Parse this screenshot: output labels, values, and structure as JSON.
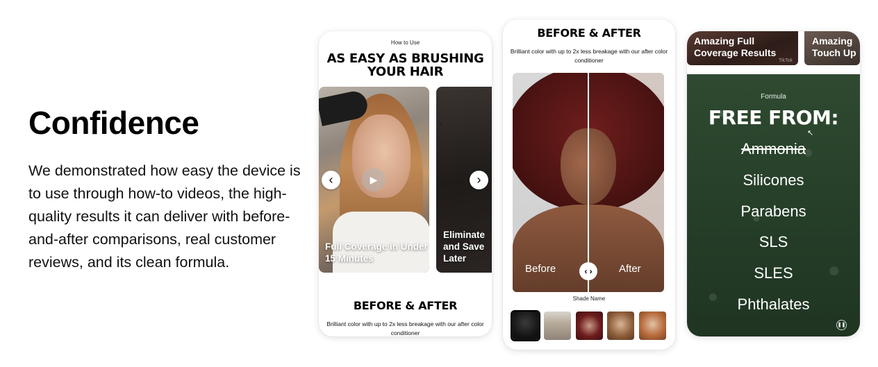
{
  "intro": {
    "title": "Confidence",
    "body": "We demonstrated how easy the device is to use through how-to videos, the high-quality results it can deliver with before-and-after comparisons, real customer reviews, and its clean formula."
  },
  "phone1": {
    "section_label": "How to Use",
    "headline": "AS EASY AS BRUSHING YOUR HAIR",
    "slides": [
      {
        "caption": "Full Coverage in Under 15 Minutes"
      },
      {
        "caption": "Eliminate and Save Later"
      }
    ],
    "prev_icon": "chevron-left-icon",
    "next_icon": "chevron-right-icon",
    "play_icon": "play-icon",
    "before_after_title": "BEFORE & AFTER",
    "before_after_sub": "Brilliant color with up to 2x less breakage with our after color conditioner"
  },
  "phone2": {
    "title": "BEFORE & AFTER",
    "subtitle": "Brilliant color with up to 2x less breakage with our after color conditioner",
    "before_label": "Before",
    "after_label": "After",
    "handle_glyph": "‹ ›",
    "shade_name_label": "Shade Name",
    "swatches": [
      "black",
      "ash blonde",
      "burgundy",
      "light brown",
      "copper"
    ]
  },
  "phone3": {
    "tiles": [
      {
        "caption": "Amazing Full Coverage Results",
        "watermark": "TikTok"
      },
      {
        "caption": "Amazing Touch Up"
      }
    ],
    "formula_label": "Formula",
    "free_from": "FREE FROM:",
    "ingredients": [
      "Ammonia",
      "Silicones",
      "Parabens",
      "SLS",
      "SLES",
      "Phthalates"
    ],
    "pause_icon": "pause-icon"
  },
  "colors": {
    "formula_green": "#2a432c",
    "text_black": "#000000"
  }
}
